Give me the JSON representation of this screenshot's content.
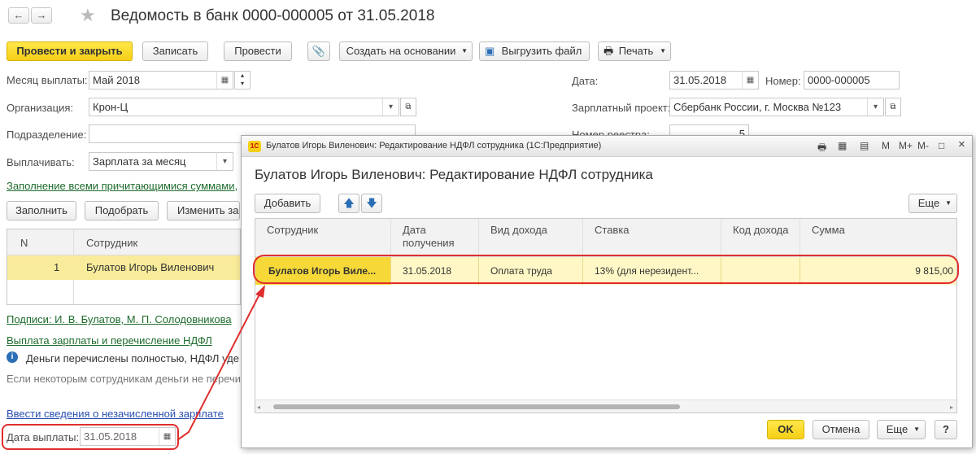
{
  "header": {
    "title": "Ведомость в банк 0000-000005 от 31.05.2018"
  },
  "toolbar": {
    "post_close": "Провести и закрыть",
    "save": "Записать",
    "post": "Провести",
    "create_based": "Создать на основании",
    "export_file": "Выгрузить файл",
    "print": "Печать"
  },
  "form": {
    "month_label": "Месяц выплаты:",
    "month_value": "Май 2018",
    "org_label": "Организация:",
    "org_value": "Крон-Ц",
    "dept_label": "Подразделение:",
    "dept_value": "",
    "pay_label": "Выплачивать:",
    "pay_value": "Зарплата за месяц",
    "fill_link": "Заполнение всеми причитающимися суммами,",
    "date_label": "Дата:",
    "date_value": "31.05.2018",
    "number_label": "Номер:",
    "number_value": "0000-000005",
    "project_label": "Зарплатный проект:",
    "project_value": "Сбербанк России, г. Москва №123",
    "registry_label": "Номер реестра:",
    "registry_value": "5"
  },
  "table_toolbar": {
    "fill": "Заполнить",
    "pick": "Подобрать",
    "change": "Изменить зар"
  },
  "table": {
    "headers": {
      "n": "N",
      "employee": "Сотрудник"
    },
    "rows": [
      {
        "n": "1",
        "employee": "Булатов Игорь Виленович"
      }
    ]
  },
  "footer": {
    "signatures_link": "Подписи: И. В. Булатов, М. П. Солодовникова",
    "payout_link": "Выплата зарплаты и перечисление НДФЛ",
    "info_text": "Деньги перечислены  полностью, НДФЛ уде",
    "hint_text": "Если некоторым сотрудникам деньги не перечис",
    "unpaid_link": "Ввести сведения о незачисленной зарплате",
    "paydate_label": "Дата выплаты:",
    "paydate_value": "31.05.2018"
  },
  "modal": {
    "window_title": "Булатов Игорь Виленович: Редактирование НДФЛ сотрудника  (1С:Предприятие)",
    "window_icons": {
      "m": "M",
      "mplus": "M+",
      "mminus": "M-",
      "restore": "□",
      "close": "×"
    },
    "heading": "Булатов Игорь Виленович: Редактирование НДФЛ сотрудника",
    "add": "Добавить",
    "more": "Еще",
    "headers": {
      "employee": "Сотрудник",
      "date": "Дата получения",
      "income_type": "Вид дохода",
      "rate": "Ставка",
      "income_code": "Код дохода",
      "sum": "Сумма"
    },
    "row": {
      "employee": "Булатов Игорь Виле...",
      "date": "31.05.2018",
      "income_type": "Оплата труда",
      "rate": "13% (для нерезидент...",
      "income_code": "",
      "sum": "9 815,00"
    },
    "ok": "OK",
    "cancel": "Отмена",
    "more2": "Еще",
    "help": "?"
  },
  "colors": {
    "accent_yellow": "#f6cf16",
    "highlight_red": "#e12d2d",
    "row_yellow": "#fff8c6",
    "link_green": "#1c6b2b"
  }
}
